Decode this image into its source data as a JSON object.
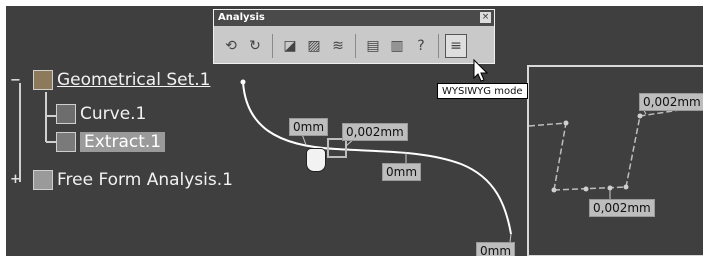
{
  "toolbar": {
    "title": "Analysis",
    "close_glyph": "×",
    "buttons": [
      {
        "icon": "curve-connect-check-icon",
        "glyph": "⟲"
      },
      {
        "icon": "curve-connect-analysis-icon",
        "glyph": "↻"
      },
      {
        "icon": "surface-curvature-icon",
        "glyph": "◪"
      },
      {
        "icon": "draft-analysis-icon",
        "glyph": "▨"
      },
      {
        "icon": "porcupine-analysis-icon",
        "glyph": "≋"
      },
      {
        "icon": "cutting-planes-icon",
        "glyph": "▤"
      },
      {
        "icon": "reflection-lines-icon",
        "glyph": "▥"
      },
      {
        "icon": "help-icon",
        "glyph": "?"
      },
      {
        "icon": "wysiwyg-mode-icon",
        "glyph": "≡"
      }
    ]
  },
  "tooltip": "WYSIWYG mode",
  "tree": {
    "items": [
      {
        "label": "Geometrical Set.1",
        "icon": "geometrical-set-icon"
      },
      {
        "label": "Curve.1",
        "icon": "curve-icon"
      },
      {
        "label": "Extract.1",
        "icon": "extract-icon"
      },
      {
        "label": "Free Form Analysis.1",
        "icon": "freeform-analysis-icon"
      }
    ]
  },
  "dimensions": {
    "start": "0mm",
    "connection": "0,002mm",
    "mid": "0mm",
    "end": "0mm"
  },
  "detail": {
    "top": "0,002mm",
    "bottom": "0,002mm"
  }
}
